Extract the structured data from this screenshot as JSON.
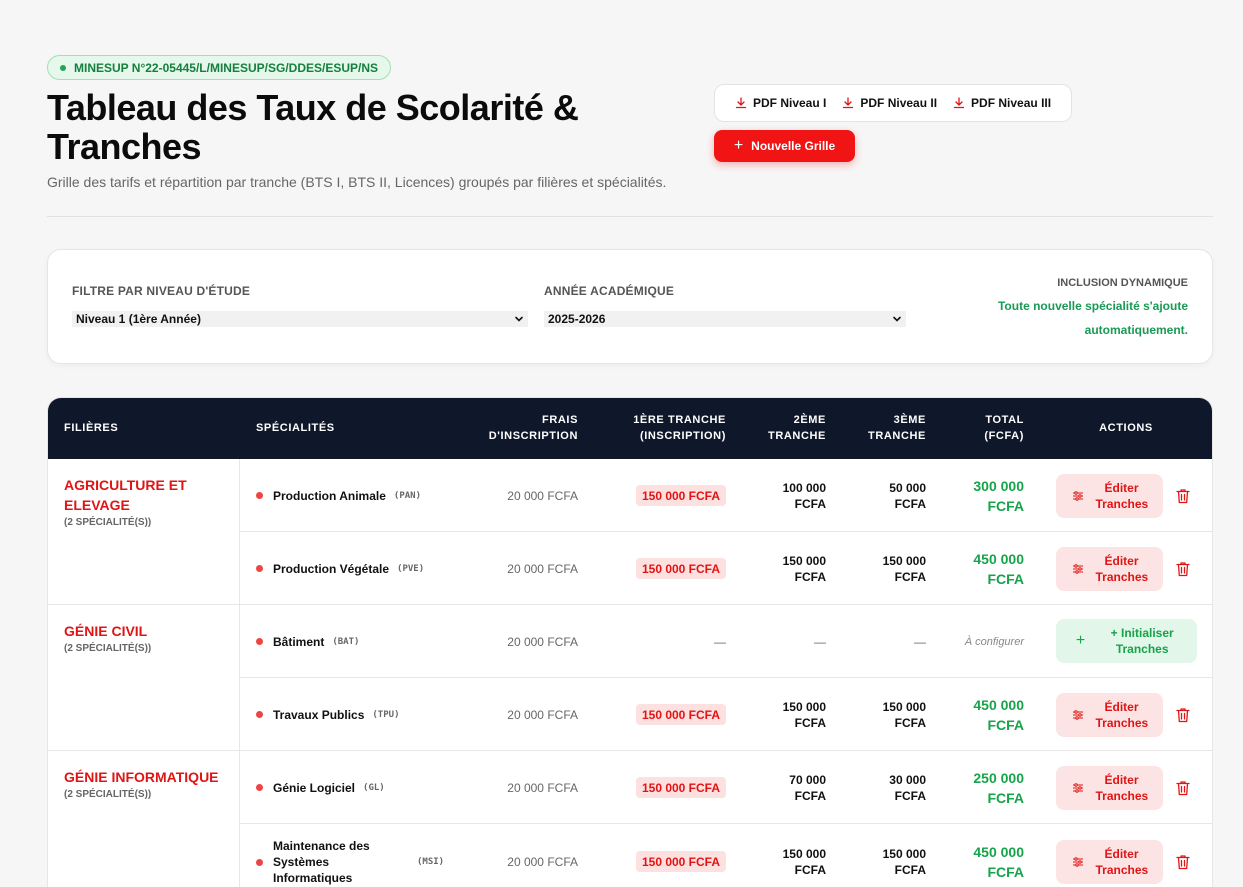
{
  "badge": {
    "text": "MINESUP N°22-05445/L/MINESUP/SG/DDES/ESUP/NS"
  },
  "header": {
    "title": "Tableau des Taux de Scolarité & Tranches",
    "subtitle": "Grille des tarifs et répartition par tranche (BTS I, BTS II, Licences) groupés par filières et spécialités."
  },
  "actions": {
    "pdf": [
      "PDF Niveau I",
      "PDF Niveau II",
      "PDF Niveau III"
    ],
    "new_grid": "Nouvelle Grille"
  },
  "filters": {
    "level_label": "FILTRE PAR NIVEAU D'ÉTUDE",
    "level_value": "Niveau 1 (1ère Année)",
    "year_label": "ANNÉE ACADÉMIQUE",
    "year_value": "2025-2026",
    "inclusion_label": "INCLUSION DYNAMIQUE",
    "inclusion_text": "Toute nouvelle spécialité s'ajoute automatiquement."
  },
  "table": {
    "headers": {
      "filieres": "FILIÈRES",
      "specialites": "SPÉCIALITÉS",
      "frais": "FRAIS D'INSCRIPTION",
      "t1": "1ÈRE TRANCHE (INSCRIPTION)",
      "t2": "2ÈME TRANCHE",
      "t3": "3ÈME TRANCHE",
      "total": "TOTAL (FCFA)",
      "actions": "ACTIONS"
    },
    "groups": [
      {
        "name": "AGRICULTURE ET ELEVAGE",
        "count": "(2 SPÉCIALITÉ(S))"
      },
      {
        "name": "GÉNIE CIVIL",
        "count": "(2 SPÉCIALITÉ(S))"
      },
      {
        "name": "GÉNIE INFORMATIQUE",
        "count": "(2 SPÉCIALITÉ(S))"
      }
    ],
    "rows": [
      {
        "name": "Production Animale",
        "code": "(PAN)",
        "fee": "20 000 FCFA",
        "t1": "150 000 FCFA",
        "t2": "100 000 FCFA",
        "t3": "50 000 FCFA",
        "total": "300 000 FCFA",
        "action": "Éditer Tranches"
      },
      {
        "name": "Production Végétale",
        "code": "(PVE)",
        "fee": "20 000 FCFA",
        "t1": "150 000 FCFA",
        "t2": "150 000 FCFA",
        "t3": "150 000 FCFA",
        "total": "450 000 FCFA",
        "action": "Éditer Tranches"
      },
      {
        "name": "Bâtiment",
        "code": "(BAT)",
        "fee": "20 000 FCFA",
        "t1": "—",
        "t2": "—",
        "t3": "—",
        "total": "À configurer",
        "action": "+ Initialiser Tranches"
      },
      {
        "name": "Travaux Publics",
        "code": "(TPU)",
        "fee": "20 000 FCFA",
        "t1": "150 000 FCFA",
        "t2": "150 000 FCFA",
        "t3": "150 000 FCFA",
        "total": "450 000 FCFA",
        "action": "Éditer Tranches"
      },
      {
        "name": "Génie Logiciel",
        "code": "(GL)",
        "fee": "20 000 FCFA",
        "t1": "150 000 FCFA",
        "t2": "70 000 FCFA",
        "t3": "30 000 FCFA",
        "total": "250 000 FCFA",
        "action": "Éditer Tranches"
      },
      {
        "name": "Maintenance des Systèmes Informatiques",
        "code": "(MSI)",
        "fee": "20 000 FCFA",
        "t1": "150 000 FCFA",
        "t2": "150 000 FCFA",
        "t3": "150 000 FCFA",
        "total": "450 000 FCFA",
        "action": "Éditer Tranches"
      }
    ]
  },
  "colors": {
    "brand_red": "#f01414",
    "header_navy": "#0f172a",
    "total_green": "#16a34a"
  },
  "icons": [
    "download-icon",
    "plus-icon",
    "chevron-down-icon",
    "sliders-icon",
    "trash-icon"
  ]
}
